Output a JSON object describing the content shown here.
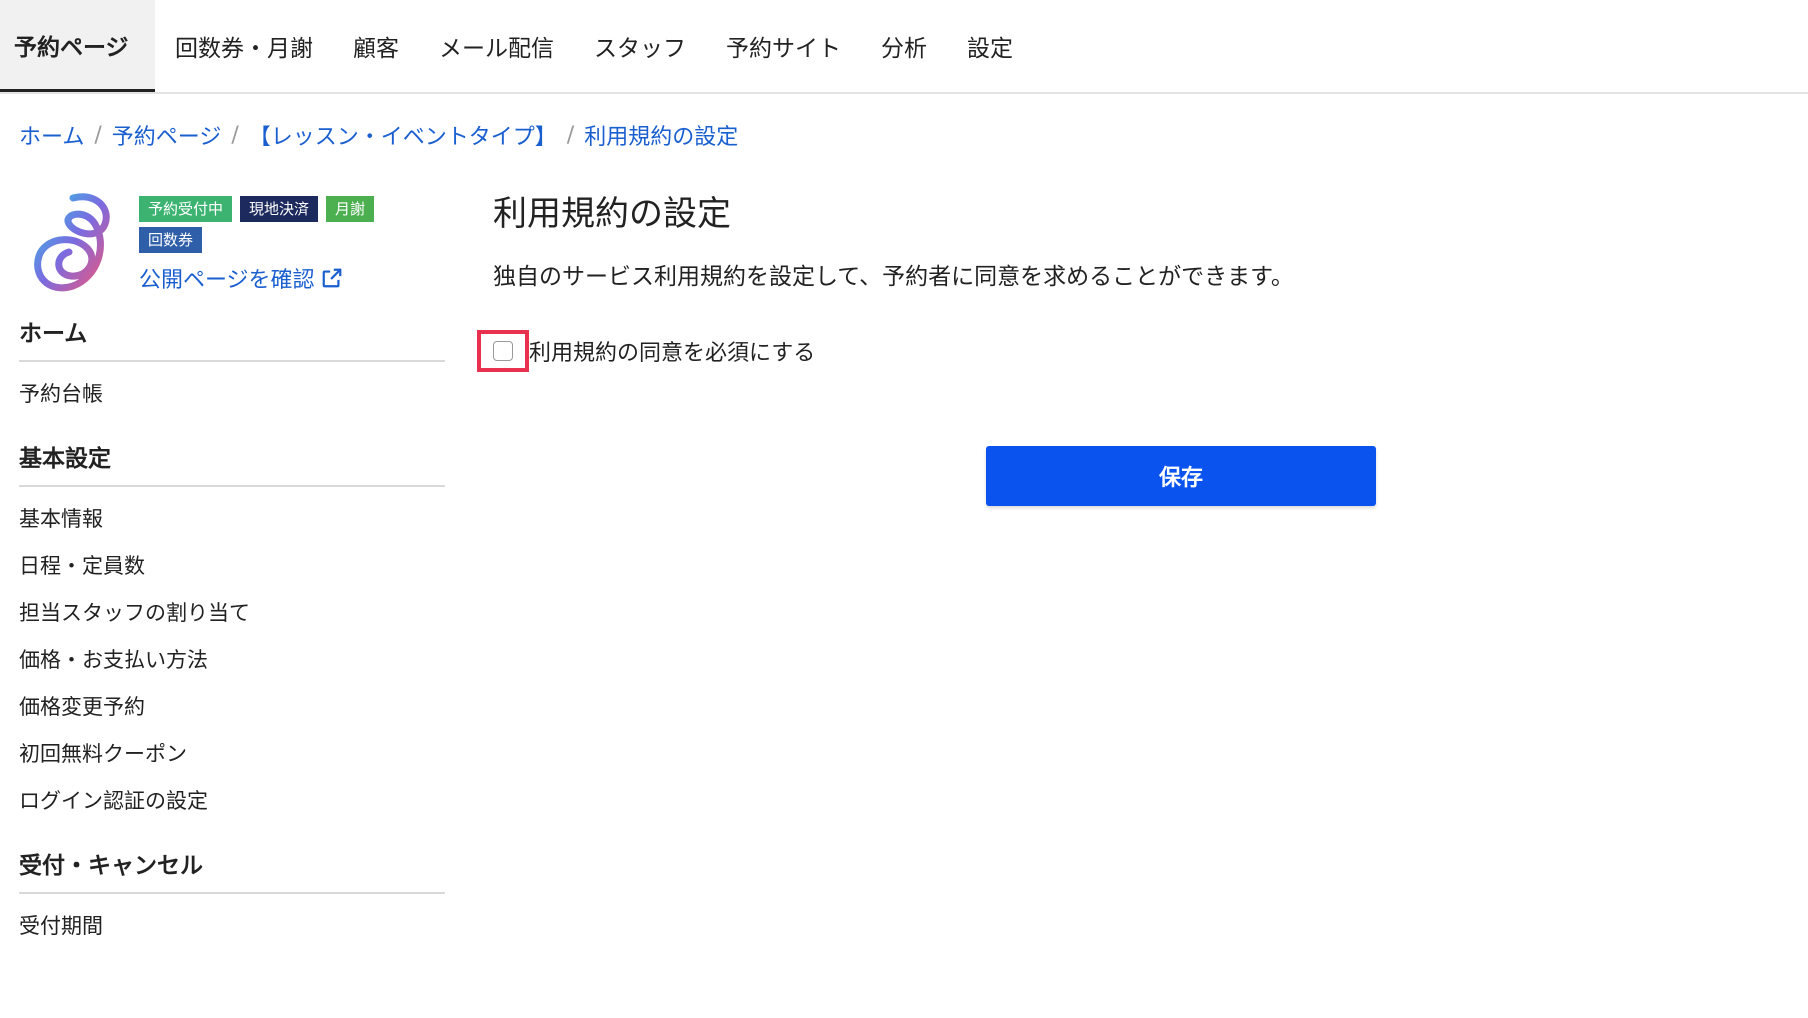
{
  "topnav": {
    "tabs": [
      {
        "label": "予約ページ",
        "active": true
      },
      {
        "label": "回数券・月謝"
      },
      {
        "label": "顧客"
      },
      {
        "label": "メール配信"
      },
      {
        "label": "スタッフ"
      },
      {
        "label": "予約サイト"
      },
      {
        "label": "分析"
      },
      {
        "label": "設定"
      }
    ]
  },
  "breadcrumb": {
    "items": [
      "ホーム",
      "予約ページ",
      "【レッスン・イベントタイプ】",
      "利用規約の設定"
    ],
    "separator": "/"
  },
  "profile": {
    "badges": [
      {
        "label": "予約受付中",
        "color": "#3cb371"
      },
      {
        "label": "現地決済",
        "color": "#1c2a5e"
      },
      {
        "label": "月謝",
        "color": "#4caf50"
      },
      {
        "label": "回数券",
        "color": "#2f5fa8"
      }
    ],
    "public_link_label": "公開ページを確認",
    "public_link_icon": "external-link-icon"
  },
  "sidebar": {
    "sections": [
      {
        "title": "ホーム",
        "items": [
          "予約台帳"
        ]
      },
      {
        "title": "基本設定",
        "items": [
          "基本情報",
          "日程・定員数",
          "担当スタッフの割り当て",
          "価格・お支払い方法",
          "価格変更予約",
          "初回無料クーポン",
          "ログイン認証の設定"
        ]
      },
      {
        "title": "受付・キャンセル",
        "items": [
          "受付期間"
        ]
      }
    ]
  },
  "main": {
    "title": "利用規約の設定",
    "description": "独自のサービス利用規約を設定して、予約者に同意を求めることができます。",
    "checkbox_label": "利用規約の同意を必須にする",
    "checkbox_checked": false,
    "save_label": "保存"
  },
  "colors": {
    "link": "#1a5fd0",
    "primary_button": "#0a53ef",
    "highlight": "#e8304f"
  }
}
